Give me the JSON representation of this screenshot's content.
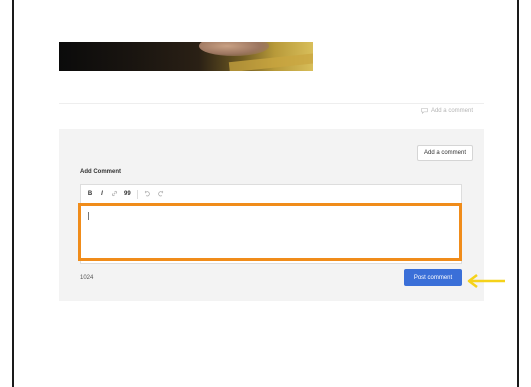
{
  "comments": {
    "add_link_label": "Add a comment",
    "top_button_label": "Add a comment",
    "section_label": "Add Comment",
    "char_counter": "1024",
    "post_button_label": "Post comment"
  },
  "toolbar": {
    "bold": "B",
    "italic": "I",
    "link_icon": "link-icon",
    "quote": "99",
    "undo_icon": "undo-icon",
    "redo_icon": "redo-icon"
  },
  "colors": {
    "highlight": "#f08c1a",
    "post_button": "#3a6fd8",
    "arrow": "#f5d21a"
  }
}
